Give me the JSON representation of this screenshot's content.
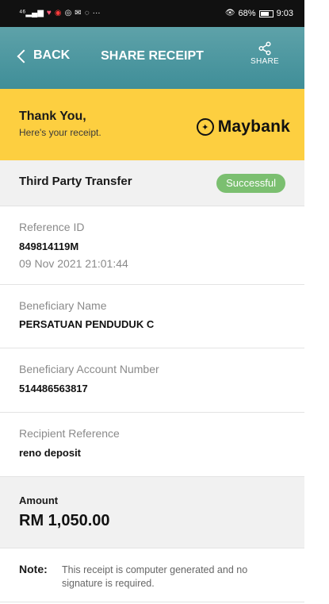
{
  "status_bar": {
    "left_text": "46",
    "icons": [
      "signal-icon",
      "heart-icon",
      "notification-icon",
      "app-icon",
      "mail-icon",
      "whatsapp-icon",
      "more-icon"
    ],
    "more": "···",
    "eye": "👁",
    "battery_percent": "68%",
    "time": "9:03"
  },
  "header": {
    "back_label": "BACK",
    "title": "SHARE RECEIPT",
    "share_label": "SHARE"
  },
  "banner": {
    "title": "Thank You,",
    "subtitle": "Here's your receipt.",
    "brand": "Maybank"
  },
  "transaction": {
    "type": "Third Party Transfer",
    "status": "Successful",
    "status_color": "#7bbf70"
  },
  "details": {
    "reference_label": "Reference ID",
    "reference_id": "849814119M",
    "datetime": "09 Nov 2021 21:01:44",
    "beneficiary_label": "Beneficiary Name",
    "beneficiary_name": "PERSATUAN PENDUDUK C",
    "account_label": "Beneficiary Account Number",
    "account_number": "514486563817",
    "recipient_ref_label": "Recipient Reference",
    "recipient_ref": "reno deposit"
  },
  "amount": {
    "label": "Amount",
    "value": "RM 1,050.00"
  },
  "note": {
    "label": "Note:",
    "text": "This receipt is computer generated and no signature is required."
  },
  "colors": {
    "header": "#4f98a1",
    "banner": "#fdcf40",
    "status_badge": "#7bbf70"
  }
}
